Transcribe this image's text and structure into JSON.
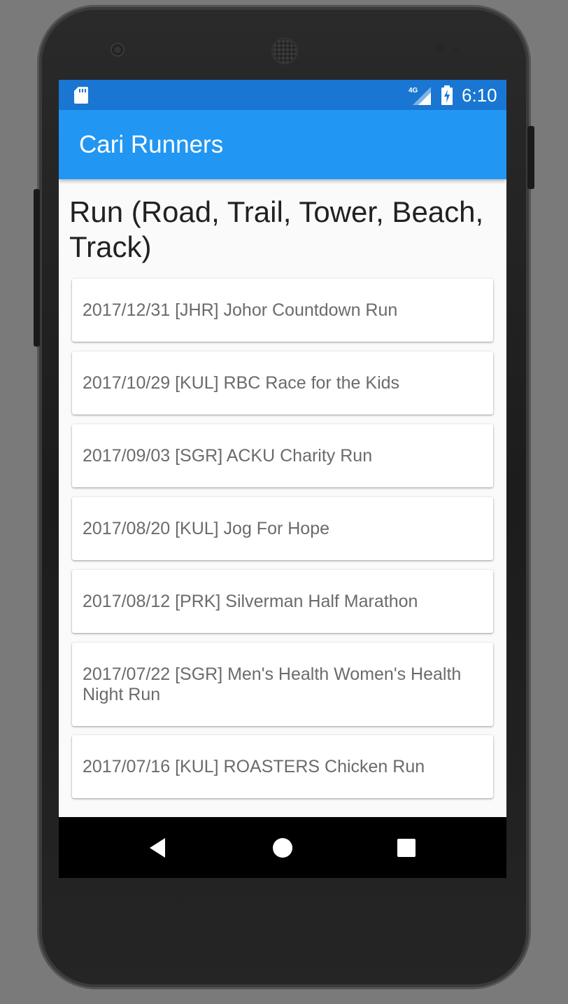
{
  "status_bar": {
    "time": "6:10",
    "network_label": "4G",
    "icons": [
      "sd-card-icon",
      "signal-icon",
      "battery-charging-icon"
    ]
  },
  "app_bar": {
    "title": "Cari Runners"
  },
  "section": {
    "heading": "Run (Road, Trail, Tower, Beach, Track)"
  },
  "events": [
    "2017/12/31 [JHR] Johor Countdown Run",
    "2017/10/29 [KUL] RBC Race for the Kids",
    "2017/09/03 [SGR] ACKU Charity Run",
    "2017/08/20 [KUL] Jog For Hope",
    "2017/08/12 [PRK] Silverman Half Marathon",
    "2017/07/22 [SGR] Men's Health Women's Health Night Run",
    "2017/07/16 [KUL] ROASTERS Chicken Run"
  ],
  "nav_bar": {
    "buttons": [
      "back-icon",
      "home-icon",
      "recents-icon"
    ]
  },
  "colors": {
    "status_bar": "#1976d2",
    "app_bar": "#2196f3",
    "card_text": "#6b6b6b",
    "heading_text": "#212121"
  }
}
